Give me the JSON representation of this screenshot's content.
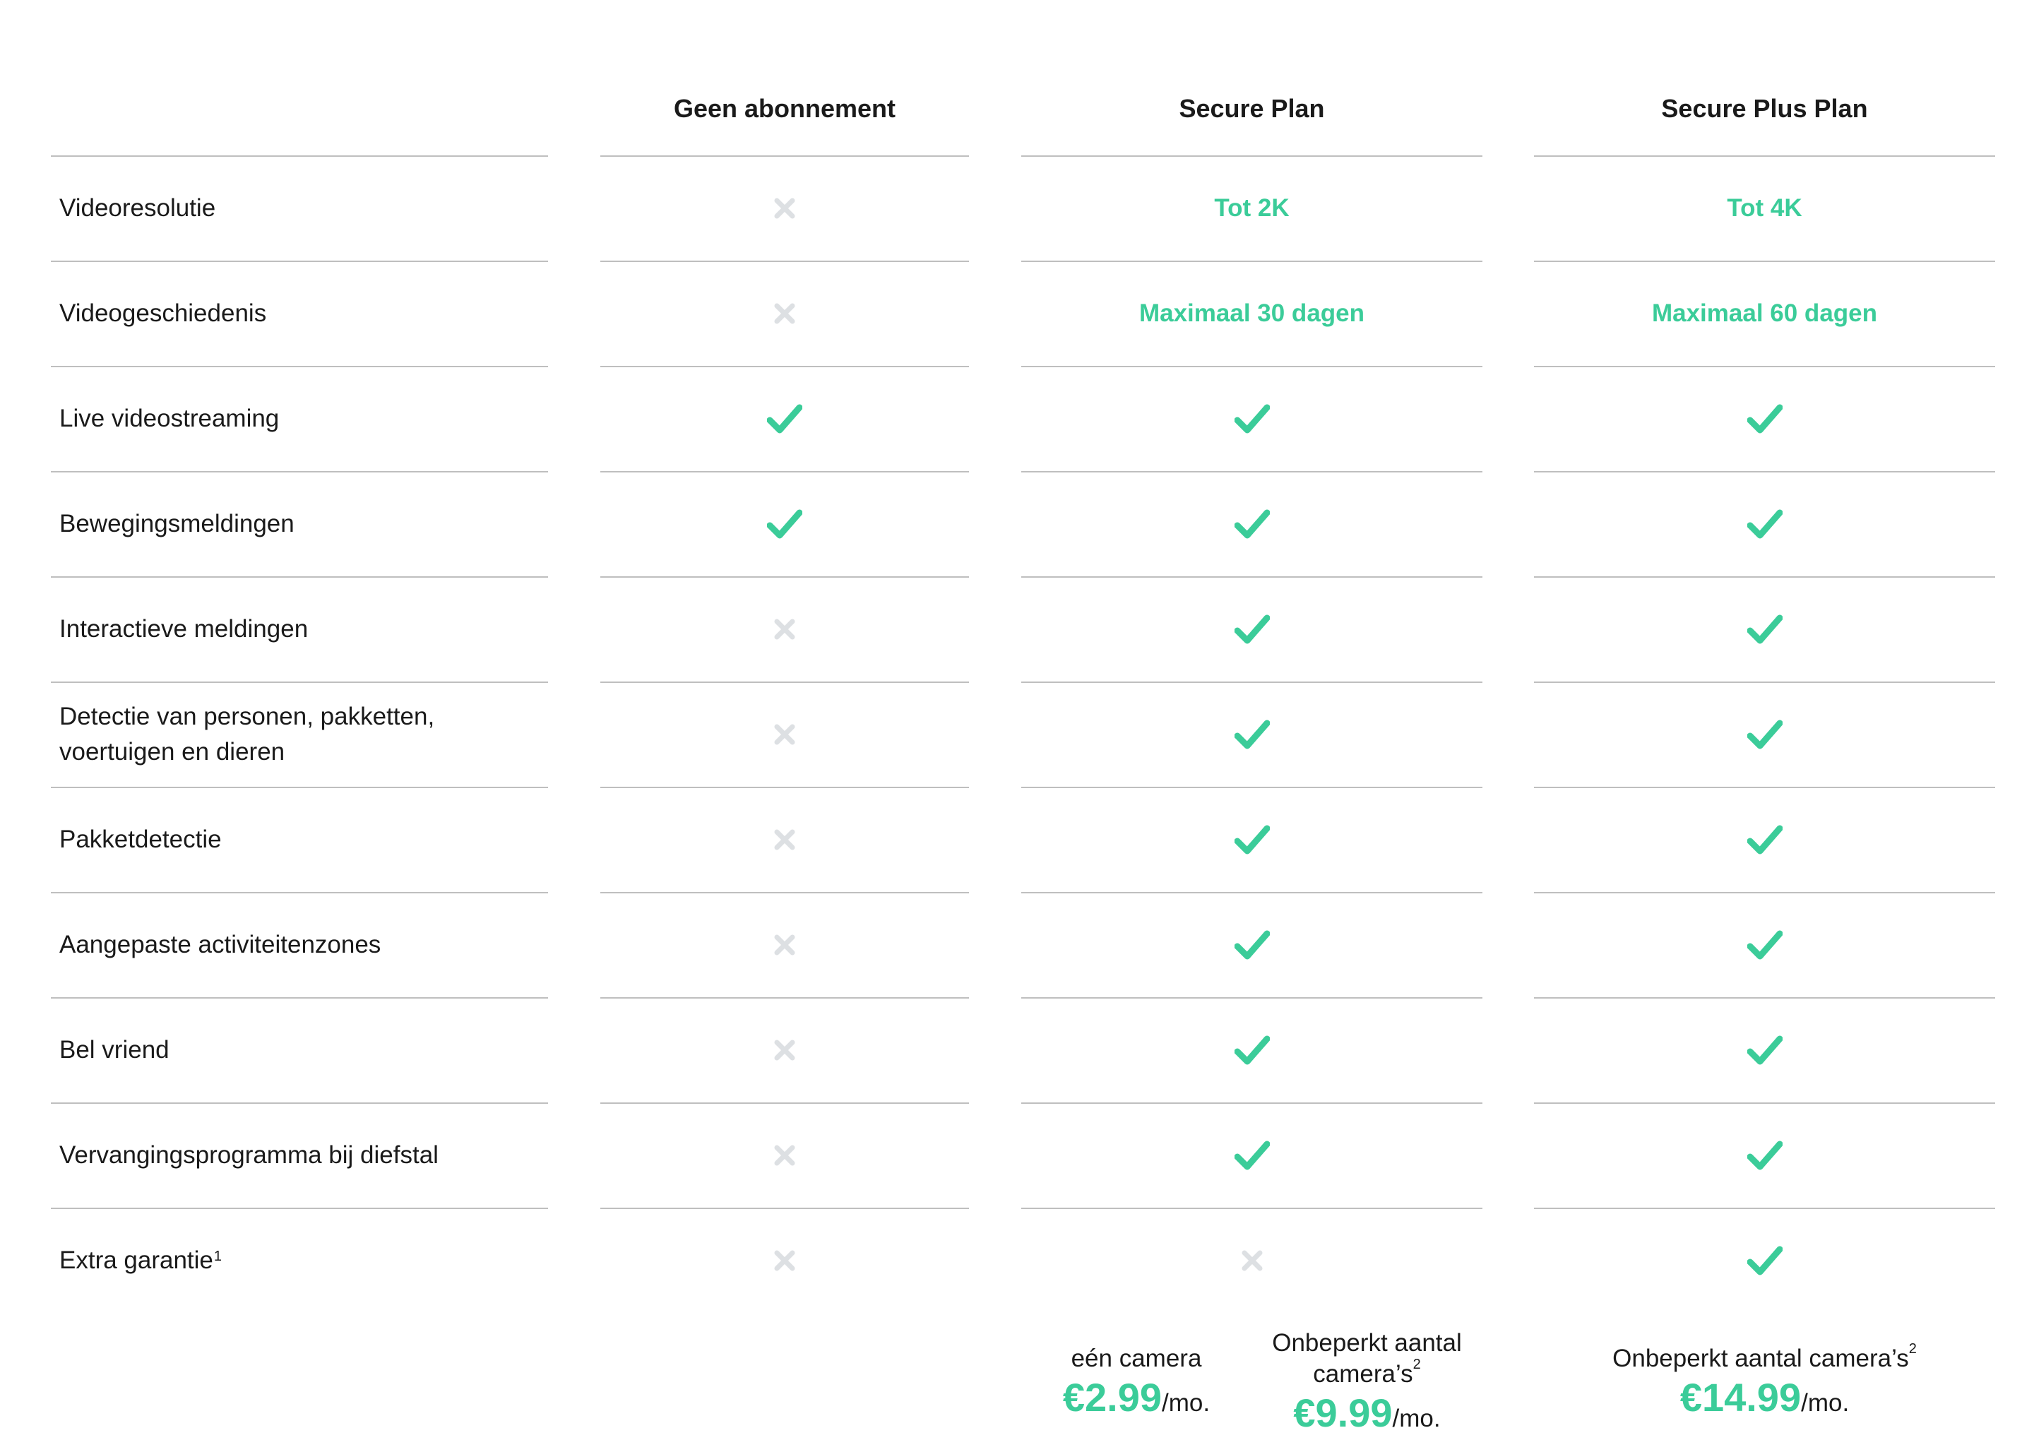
{
  "header": {
    "col1": "Geen abonnement",
    "col2": "Secure Plan",
    "col3": "Secure Plus Plan"
  },
  "rows": [
    {
      "label": "Videoresolutie",
      "c1": {
        "type": "cross"
      },
      "c2": {
        "type": "text",
        "value": "Tot 2K"
      },
      "c3": {
        "type": "text",
        "value": "Tot 4K"
      }
    },
    {
      "label": "Videogeschiedenis",
      "c1": {
        "type": "cross"
      },
      "c2": {
        "type": "text",
        "value": "Maximaal 30 dagen"
      },
      "c3": {
        "type": "text",
        "value": "Maximaal 60 dagen"
      }
    },
    {
      "label": "Live videostreaming",
      "c1": {
        "type": "check"
      },
      "c2": {
        "type": "check"
      },
      "c3": {
        "type": "check"
      }
    },
    {
      "label": "Bewegingsmeldingen",
      "c1": {
        "type": "check"
      },
      "c2": {
        "type": "check"
      },
      "c3": {
        "type": "check"
      }
    },
    {
      "label": "Interactieve meldingen",
      "c1": {
        "type": "cross"
      },
      "c2": {
        "type": "check"
      },
      "c3": {
        "type": "check"
      }
    },
    {
      "label": "Detectie van personen, pakketten, voertuigen en dieren",
      "c1": {
        "type": "cross"
      },
      "c2": {
        "type": "check"
      },
      "c3": {
        "type": "check"
      }
    },
    {
      "label": "Pakketdetectie",
      "c1": {
        "type": "cross"
      },
      "c2": {
        "type": "check"
      },
      "c3": {
        "type": "check"
      }
    },
    {
      "label": "Aangepaste activiteitenzones",
      "c1": {
        "type": "cross"
      },
      "c2": {
        "type": "check"
      },
      "c3": {
        "type": "check"
      }
    },
    {
      "label": "Bel vriend",
      "c1": {
        "type": "cross"
      },
      "c2": {
        "type": "check"
      },
      "c3": {
        "type": "check"
      }
    },
    {
      "label": "Vervangingsprogramma bij diefstal",
      "c1": {
        "type": "cross"
      },
      "c2": {
        "type": "check"
      },
      "c3": {
        "type": "check"
      }
    },
    {
      "label": "Extra garantie",
      "label_sup": "1",
      "c1": {
        "type": "cross"
      },
      "c2": {
        "type": "cross"
      },
      "c3": {
        "type": "check"
      }
    }
  ],
  "pricing": {
    "secure_single": {
      "desc": "eén camera",
      "price": "€2.99",
      "per": "/mo."
    },
    "secure_unlimited": {
      "desc": "Onbeperkt aantal camera’s",
      "sup": "2",
      "price": "€9.99",
      "per": "/mo."
    },
    "plus_unlimited": {
      "desc": "Onbeperkt aantal camera’s",
      "sup": "2",
      "price": "€14.99",
      "per": "/mo."
    }
  },
  "colors": {
    "accent": "#3bcc99",
    "cross": "#dde0e3",
    "rule": "#bfbfbf",
    "text": "#1a1a1a"
  },
  "icons": {
    "yes": "checkmark-icon",
    "no": "cross-icon"
  }
}
